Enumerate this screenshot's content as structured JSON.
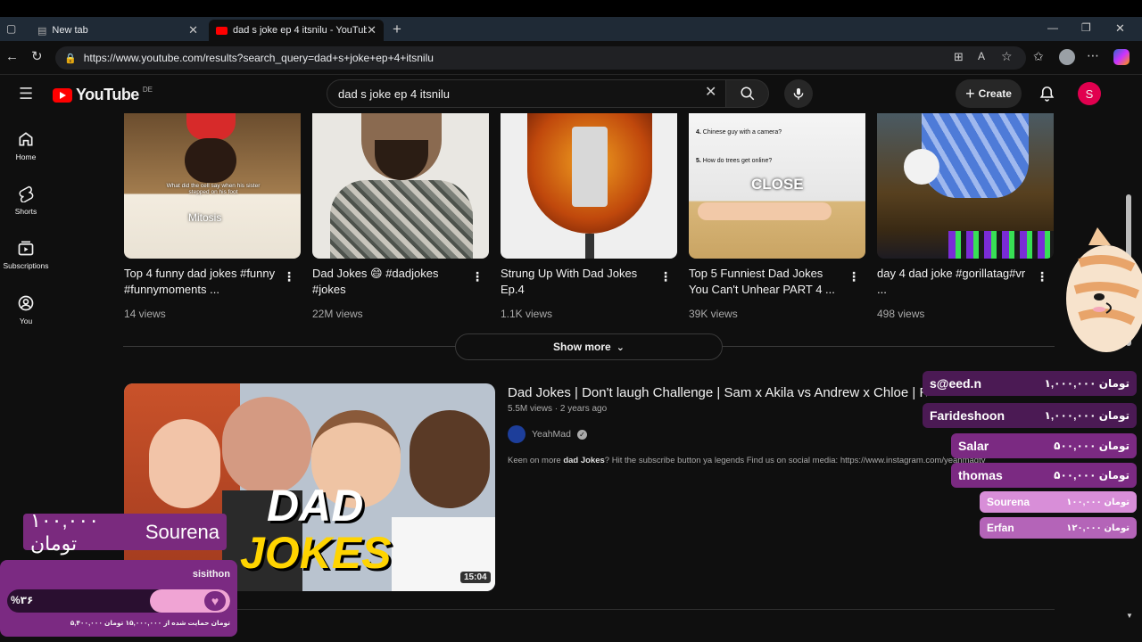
{
  "browser": {
    "tabs": [
      {
        "label": "New tab"
      },
      {
        "label": "dad s joke ep 4 itsnilu - YouTube"
      }
    ],
    "url": "https://www.youtube.com/results?search_query=dad+s+joke+ep+4+itsnilu"
  },
  "youtube": {
    "logo_text": "YouTube",
    "country_code": "DE",
    "search_query": "dad s joke ep 4 itsnilu",
    "create_label": "Create",
    "avatar_letter": "S",
    "nav": [
      {
        "label": "Home"
      },
      {
        "label": "Shorts"
      },
      {
        "label": "Subscriptions"
      },
      {
        "label": "You"
      }
    ],
    "shorts": [
      {
        "title": "Top 4 funny dad jokes #funny #funnymoments ...",
        "views": "14 views",
        "overlay": "Mitosis",
        "overlay_small": "What did the cell say when his sister stepped on his foot"
      },
      {
        "title": "Dad Jokes 😄 #dadjokes #jokes",
        "views": "22M views"
      },
      {
        "title": "Strung Up With Dad Jokes Ep.4",
        "views": "1.1K views"
      },
      {
        "title": "Top 5 Funniest Dad Jokes You Can't Unhear PART 4 ...",
        "views": "39K views",
        "overlay": "CLOSE",
        "overlay_small": "Chinese guy with a camera?",
        "overlay_small2": "How do trees get online?"
      },
      {
        "title": "day 4 dad joke #gorillatag#vr ...",
        "views": "498 views"
      }
    ],
    "show_more": "Show more",
    "video": {
      "title": "Dad Jokes | Don't laugh Challenge | Sam x Akila vs Andrew x Chloe | Ra",
      "meta": "5.5M views · 2 years ago",
      "channel": "YeahMad",
      "description_pre": "Keen on more ",
      "description_bold": "dad Jokes",
      "description_post": "? Hit the subscribe button ya legends Find us on social media: https://www.instagram.com/yeahmadtv",
      "thumb_text_1": "DAD",
      "thumb_text_2": "JOKES",
      "duration": "15:04"
    }
  },
  "stream_overlay": {
    "big_donation": {
      "name": "Sourena",
      "amount": "۱۰۰,۰۰۰ تومان"
    },
    "donations": [
      {
        "name": "s@eed.n",
        "amount": "۱,۰۰۰,۰۰۰ تومان"
      },
      {
        "name": "Farideshoon",
        "amount": "۱,۰۰۰,۰۰۰ تومان"
      },
      {
        "name": "Salar",
        "amount": "۵۰۰,۰۰۰ تومان"
      },
      {
        "name": "thomas",
        "amount": "۵۰۰,۰۰۰ تومان"
      },
      {
        "name": "Sourena",
        "amount": "۱۰۰,۰۰۰ تومان"
      },
      {
        "name": "Erfan",
        "amount": "۱۲۰,۰۰۰ تومان"
      }
    ],
    "goal": {
      "name": "sisithon",
      "percent_label": "%۳۶",
      "percent": 36,
      "caption": "۵,۴۰۰,۰۰۰ تومان حمایت شده از ۱۵,۰۰۰,۰۰۰ تومان"
    }
  },
  "colors": {
    "youtube_red": "#ff0000",
    "overlay_purple": "#7b2a82",
    "overlay_pink": "#d88ed8"
  }
}
